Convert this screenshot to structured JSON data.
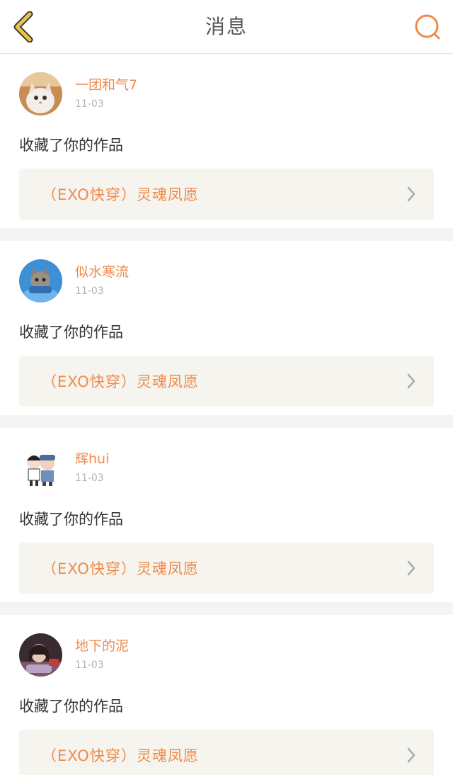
{
  "header": {
    "title": "消息",
    "back_icon": "chevron-left-icon",
    "search_icon": "search-icon",
    "accent_color": "#f08a4b",
    "back_color": "#e7c44a"
  },
  "messages": [
    {
      "username": "一团和气7",
      "date": "11-03",
      "action": "收藏了你的作品",
      "work_title": "（EXO快穿）灵魂凤愿"
    },
    {
      "username": "似水寒流",
      "date": "11-03",
      "action": "收藏了你的作品",
      "work_title": "（EXO快穿）灵魂凤愿"
    },
    {
      "username": "辉hui",
      "date": "11-03",
      "action": "收藏了你的作品",
      "work_title": "（EXO快穿）灵魂凤愿"
    },
    {
      "username": "地下的泥",
      "date": "11-03",
      "action": "收藏了你的作品",
      "work_title": "（EXO快穿）灵魂凤愿"
    }
  ]
}
